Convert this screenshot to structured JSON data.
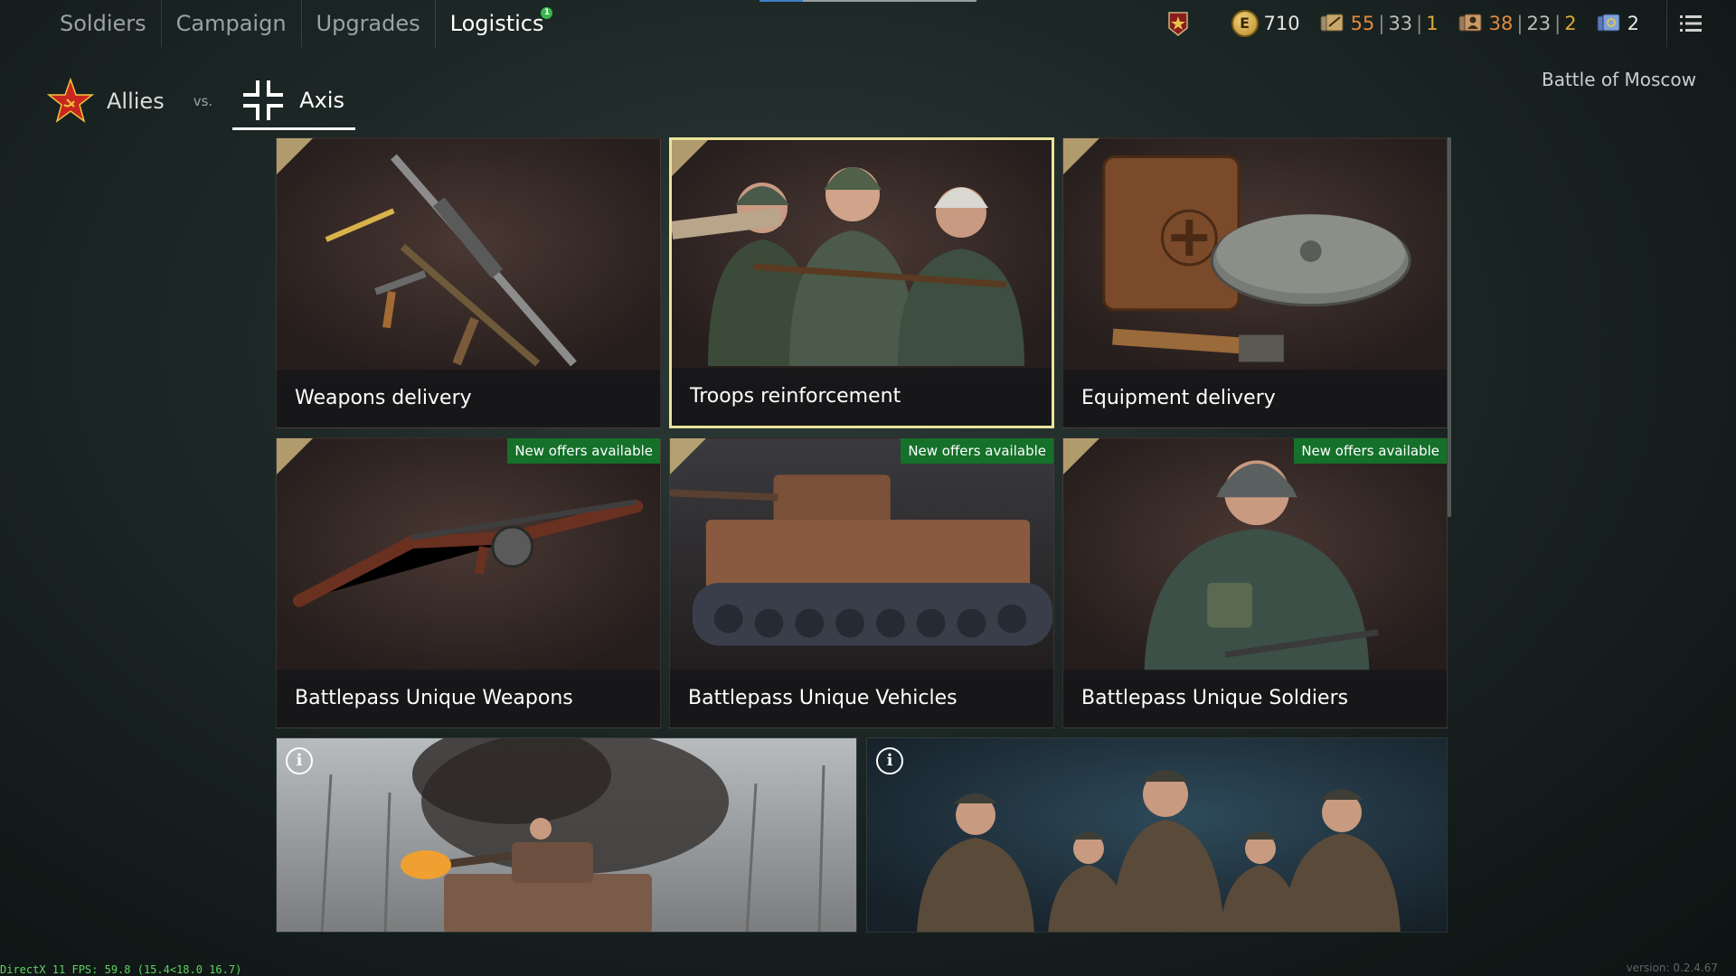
{
  "nav": {
    "tabs": [
      {
        "label": "Soldiers"
      },
      {
        "label": "Campaign"
      },
      {
        "label": "Upgrades"
      },
      {
        "label": "Logistics",
        "notification": "1"
      }
    ]
  },
  "resources": {
    "gold": "710",
    "weapons": {
      "a": "55",
      "b": "33",
      "c": "1"
    },
    "soldiers": {
      "a": "38",
      "b": "23",
      "c": "2"
    },
    "tickets": "2"
  },
  "factions": {
    "allies": "Allies",
    "vs": "vs.",
    "axis": "Axis"
  },
  "campaign_name": "Battle of Moscow",
  "cards": [
    {
      "label": "Weapons delivery"
    },
    {
      "label": "Troops reinforcement"
    },
    {
      "label": "Equipment delivery"
    },
    {
      "label": "Battlepass Unique Weapons",
      "badge": "New offers available"
    },
    {
      "label": "Battlepass Unique Vehicles",
      "badge": "New offers available"
    },
    {
      "label": "Battlepass Unique Soldiers",
      "badge": "New offers available"
    }
  ],
  "banners": [
    {
      "info": "i"
    },
    {
      "info": "i"
    }
  ],
  "footer": {
    "fps": "DirectX 11 FPS: 59.8 (15.4<18.0 16.7)",
    "version": "version: 0.2.4.67"
  },
  "colors": {
    "badge_green": "#15702a",
    "selected_border": "#ece39a",
    "resource_orange": "#e38a3a",
    "gold": "#e0a83a"
  }
}
